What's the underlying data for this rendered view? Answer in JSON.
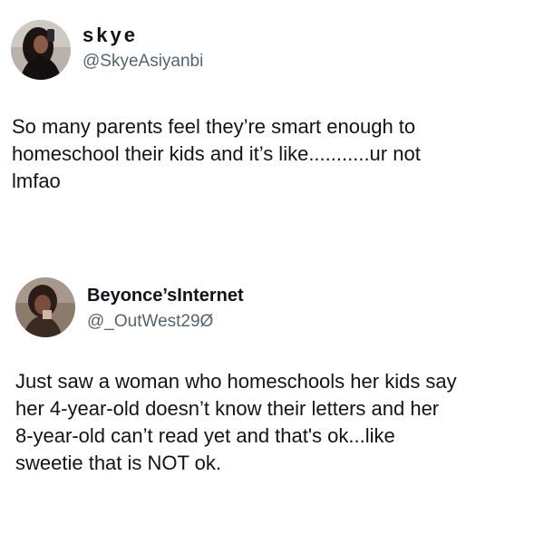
{
  "tweets": [
    {
      "display_name": "skye",
      "handle": "@SkyeAsiyanbi",
      "text_lines": [
        "So many parents feel they’re smart enough to",
        "homeschool their kids and it’s like...........ur not",
        "lmfao"
      ]
    },
    {
      "display_name": "Beyonce’sInternet",
      "handle": "@_OutWest29Ø",
      "text_lines": [
        "Just saw a woman who homeschools her kids say",
        "her 4-year-old doesn’t know their letters and her",
        "8-year-old can’t read yet and that's ok...like",
        "sweetie that is NOT ok."
      ]
    }
  ]
}
